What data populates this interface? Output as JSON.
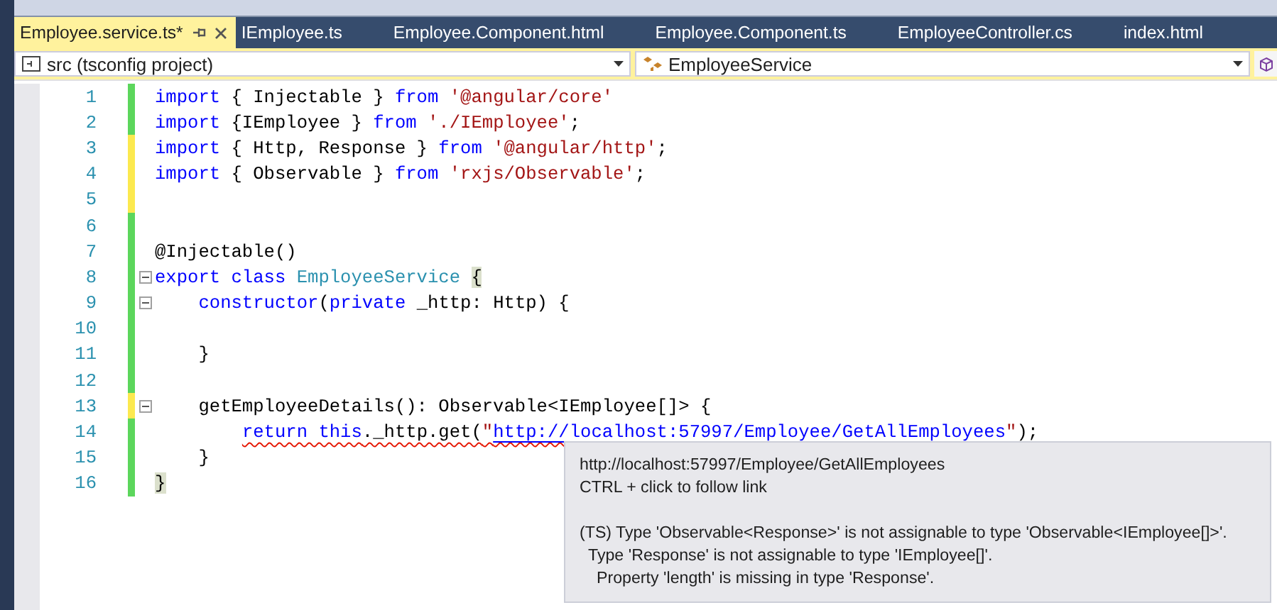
{
  "tabs": [
    {
      "label": "Employee.service.ts*",
      "selected": true
    },
    {
      "label": "IEmployee.ts",
      "selected": false
    },
    {
      "label": "Employee.Component.html",
      "selected": false
    },
    {
      "label": "Employee.Component.ts",
      "selected": false
    },
    {
      "label": "EmployeeController.cs",
      "selected": false
    },
    {
      "label": "index.html",
      "selected": false
    }
  ],
  "navigation": {
    "project": "src (tsconfig project)",
    "member": "EmployeeService"
  },
  "editor": {
    "lines": [
      {
        "number": "1",
        "saved": true,
        "fold": false,
        "error": false,
        "tokens": [
          {
            "kind": "keyword",
            "text": "import"
          },
          {
            "kind": "plain",
            "text": " { Injectable } "
          },
          {
            "kind": "keyword",
            "text": "from"
          },
          {
            "kind": "string",
            "text": " '@angular/core'"
          }
        ]
      },
      {
        "number": "2",
        "saved": true,
        "fold": false,
        "error": false,
        "tokens": [
          {
            "kind": "keyword",
            "text": "import"
          },
          {
            "kind": "plain",
            "text": " {IEmployee } "
          },
          {
            "kind": "keyword",
            "text": "from"
          },
          {
            "kind": "string",
            "text": " './IEmployee'"
          },
          {
            "kind": "plain",
            "text": ";"
          }
        ]
      },
      {
        "number": "3",
        "saved": false,
        "fold": false,
        "error": false,
        "tokens": [
          {
            "kind": "keyword",
            "text": "import"
          },
          {
            "kind": "plain",
            "text": " { Http, Response } "
          },
          {
            "kind": "keyword",
            "text": "from"
          },
          {
            "kind": "string",
            "text": " '@angular/http'"
          },
          {
            "kind": "plain",
            "text": ";"
          }
        ]
      },
      {
        "number": "4",
        "saved": false,
        "fold": false,
        "error": false,
        "tokens": [
          {
            "kind": "keyword",
            "text": "import"
          },
          {
            "kind": "plain",
            "text": " { Observable } "
          },
          {
            "kind": "keyword",
            "text": "from"
          },
          {
            "kind": "string",
            "text": " 'rxjs/Observable'"
          },
          {
            "kind": "plain",
            "text": ";"
          }
        ]
      },
      {
        "number": "5",
        "saved": false,
        "fold": false,
        "error": false
      },
      {
        "number": "6",
        "saved": true,
        "fold": false,
        "error": false
      },
      {
        "number": "7",
        "saved": true,
        "fold": false,
        "error": false,
        "tokens": [
          {
            "kind": "plain",
            "text": "@Injectable()"
          }
        ]
      },
      {
        "number": "8",
        "saved": true,
        "fold": true,
        "error": false,
        "tokens": [
          {
            "kind": "keyword",
            "text": "export class"
          },
          {
            "kind": "type",
            "text": " EmployeeService "
          },
          {
            "kind": "match",
            "text": "{"
          }
        ]
      },
      {
        "number": "9",
        "saved": true,
        "fold": true,
        "error": false,
        "tokens": [
          {
            "kind": "keyword",
            "text": "    constructor"
          },
          {
            "kind": "plain",
            "text": "("
          },
          {
            "kind": "keyword",
            "text": "private"
          },
          {
            "kind": "plain",
            "text": " _http: Http) {"
          }
        ]
      },
      {
        "number": "10",
        "saved": true,
        "fold": false,
        "error": false
      },
      {
        "number": "11",
        "saved": true,
        "fold": false,
        "error": false,
        "tokens": [
          {
            "kind": "plain",
            "text": "    }"
          }
        ]
      },
      {
        "number": "12",
        "saved": true,
        "fold": false,
        "error": false
      },
      {
        "number": "13",
        "saved": false,
        "fold": true,
        "error": false,
        "tokens": [
          {
            "kind": "plain",
            "text": "    getEmployeeDetails(): Observable<IEmployee[]> {"
          }
        ]
      },
      {
        "number": "14",
        "saved": true,
        "fold": false,
        "error": true,
        "tokens": [
          {
            "kind": "keyword",
            "text": "        return this"
          },
          {
            "kind": "plain",
            "text": "._http.get("
          },
          {
            "kind": "string",
            "text": "\""
          },
          {
            "kind": "link",
            "text": "http://localhost:57997/Employee/GetAllEmployees"
          },
          {
            "kind": "string",
            "text": "\""
          },
          {
            "kind": "plain",
            "text": ");"
          }
        ]
      },
      {
        "number": "15",
        "saved": true,
        "fold": false,
        "error": false,
        "tokens": [
          {
            "kind": "plain",
            "text": "    }"
          }
        ]
      },
      {
        "number": "16",
        "saved": true,
        "fold": false,
        "error": false,
        "tokens": [
          {
            "kind": "match",
            "text": "}"
          }
        ]
      }
    ]
  },
  "tooltip": {
    "url": "http://localhost:57997/Employee/GetAllEmployees",
    "hint": "CTRL + click to follow link",
    "message": {
      "text": "(TS) Type 'Observable<Response>' is not assignable to type 'Observable<IEmployee[]>'.",
      "children": [
        {
          "text": "Type 'Response' is not assignable to type 'IEmployee[]'.",
          "children": [
            {
              "text": "Property 'length' is missing in type 'Response'."
            }
          ]
        }
      ]
    }
  }
}
